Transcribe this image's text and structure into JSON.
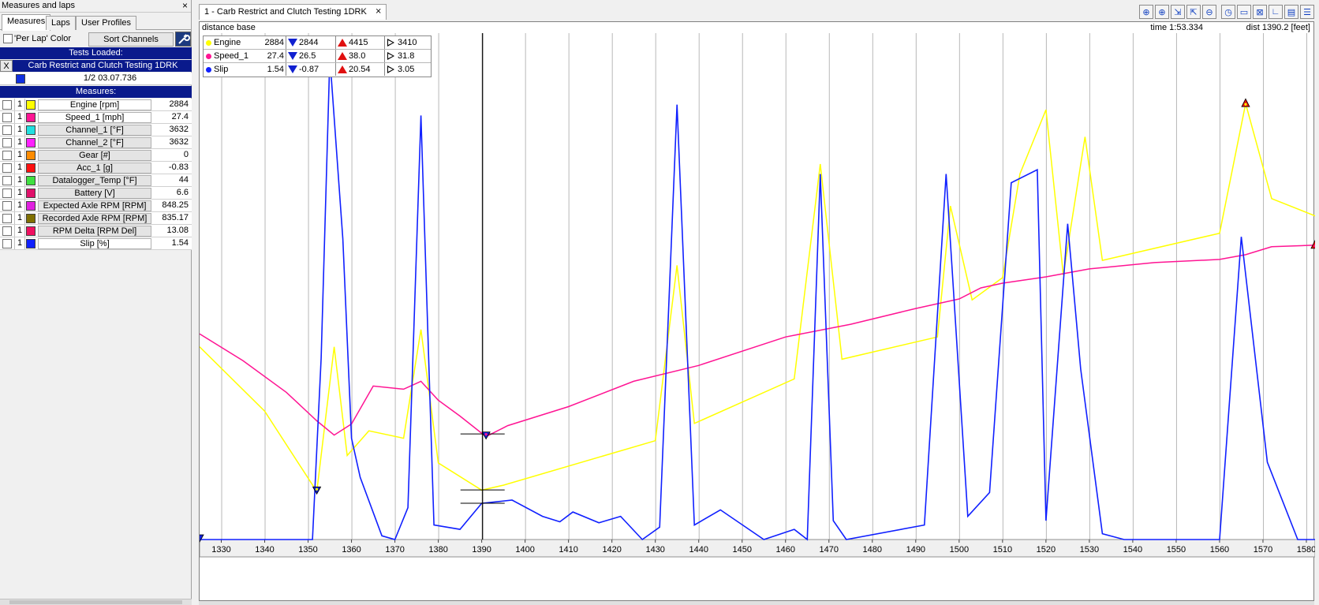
{
  "left_panel": {
    "title": "Measures and laps",
    "close": "×",
    "tabs": [
      "Measures",
      "Laps",
      "User Profiles"
    ],
    "per_lap_color": "'Per Lap' Color",
    "sort_channels": "Sort Channels",
    "tests_loaded": "Tests Loaded:",
    "test_close": "X",
    "test_name": "Carb Restrict and Clutch Testing 1DRK",
    "lap": "1/2 03.07.736",
    "measures_header": "Measures:",
    "measures": [
      {
        "num": "1",
        "color": "#ffff00",
        "label": "Engine     [rpm]",
        "value": "2884"
      },
      {
        "num": "1",
        "color": "#ff1493",
        "label": "Speed_1     [mph]",
        "value": "27.4"
      },
      {
        "num": "1",
        "color": "#20e0e0",
        "label": "Channel_1     [°F]",
        "value": "3632"
      },
      {
        "num": "1",
        "color": "#ff20ff",
        "label": "Channel_2     [°F]",
        "value": "3632"
      },
      {
        "num": "1",
        "color": "#ff8c00",
        "label": "Gear     [#]",
        "value": "0"
      },
      {
        "num": "1",
        "color": "#ff1010",
        "label": "Acc_1     [g]",
        "value": "-0.83"
      },
      {
        "num": "1",
        "color": "#40e040",
        "label": "Datalogger_Temp     [°F]",
        "value": "44"
      },
      {
        "num": "1",
        "color": "#e0106a",
        "label": "Battery     [V]",
        "value": "6.6"
      },
      {
        "num": "1",
        "color": "#e020e0",
        "label": "Expected Axle RPM     [RPM]",
        "value": "848.25"
      },
      {
        "num": "1",
        "color": "#807000",
        "label": "Recorded Axle RPM     [RPM]",
        "value": "835.17"
      },
      {
        "num": "1",
        "color": "#f01060",
        "label": "RPM Delta     [RPM Del]",
        "value": "13.08"
      },
      {
        "num": "1",
        "color": "#1020ff",
        "label": "Slip     [%]",
        "value": "1.54"
      }
    ]
  },
  "document": {
    "tab_title": "1 - Carb Restrict and Clutch Testing 1DRK",
    "tab_close": "⨯",
    "base": "distance base",
    "time": "time 1:53.334",
    "dist": "dist 1390.2 [feet]"
  },
  "toolbar": {
    "icons": [
      "zoom-2d-icon",
      "zoom-icon",
      "cursor-icon",
      "cursor-select-icon",
      "zoom-out-icon",
      "clock-icon",
      "image-icon",
      "no-image-icon",
      "layout-single-icon",
      "layout-split-icon",
      "layout-list-icon"
    ],
    "glyphs": [
      "⊕",
      "⊕",
      "⇲",
      "⇱",
      "⊖",
      "◷",
      "▭",
      "⊠",
      "∟",
      "▤",
      "☰"
    ]
  },
  "legend": [
    {
      "name": "Engine",
      "color": "#ffff00",
      "value": "2884",
      "min": "2844",
      "max": "4415",
      "avg": "3410"
    },
    {
      "name": "Speed_1",
      "color": "#ff1493",
      "value": "27.4",
      "min": "26.5",
      "max": "38.0",
      "avg": "31.8"
    },
    {
      "name": "Slip",
      "color": "#1020ff",
      "value": "1.54",
      "min": "-0.87",
      "max": "20.54",
      "avg": "3.05"
    }
  ],
  "chart_data": {
    "type": "line",
    "x_ticks": [
      1330,
      1340,
      1350,
      1360,
      1370,
      1380,
      1390,
      1400,
      1410,
      1420,
      1430,
      1440,
      1450,
      1460,
      1470,
      1480,
      1490,
      1500,
      1510,
      1520,
      1530,
      1540,
      1550,
      1560,
      1570,
      1580
    ],
    "xlim": [
      1325,
      1582
    ],
    "cursor_x": 1390.2,
    "grid": "vertical",
    "series": [
      {
        "name": "Engine",
        "color": "#ffff00",
        "ylim": [
          2650,
          4700
        ],
        "x": [
          1325,
          1340,
          1352,
          1356,
          1359,
          1364,
          1372,
          1376,
          1380,
          1390,
          1395,
          1430,
          1435,
          1439,
          1462,
          1468,
          1473,
          1495,
          1498,
          1503,
          1510,
          1514,
          1520,
          1524,
          1529,
          1533,
          1560,
          1566,
          1572,
          1582
        ],
        "y": [
          3430,
          3170,
          2844,
          3430,
          2990,
          3090,
          3060,
          3500,
          2960,
          2850,
          2870,
          3050,
          3760,
          3120,
          3300,
          4170,
          3380,
          3470,
          4000,
          3620,
          3710,
          4130,
          4390,
          3720,
          4280,
          3780,
          3890,
          4415,
          4030,
          3960
        ]
      },
      {
        "name": "Speed_1",
        "color": "#ff1493",
        "ylim": [
          20,
          52
        ],
        "x": [
          1325,
          1335,
          1345,
          1352,
          1356,
          1360,
          1365,
          1372,
          1376,
          1380,
          1385,
          1391,
          1396,
          1410,
          1425,
          1440,
          1460,
          1475,
          1490,
          1500,
          1505,
          1510,
          1520,
          1530,
          1545,
          1560,
          1566,
          1572,
          1582
        ],
        "y": [
          33.0,
          31.3,
          29.3,
          27.5,
          26.6,
          27.3,
          29.7,
          29.5,
          30.0,
          28.8,
          27.8,
          26.5,
          27.2,
          28.4,
          30.0,
          31.0,
          32.8,
          33.6,
          34.6,
          35.2,
          35.9,
          36.2,
          36.6,
          37.1,
          37.5,
          37.7,
          38.0,
          38.5,
          38.6
        ]
      },
      {
        "name": "Slip",
        "color": "#1020ff",
        "ylim": [
          -0.87,
          22.5
        ],
        "x": [
          1325,
          1351,
          1353,
          1355,
          1358,
          1360,
          1362,
          1367,
          1370,
          1373,
          1376,
          1379,
          1385,
          1390,
          1397,
          1404,
          1408,
          1411,
          1417,
          1422,
          1427,
          1431,
          1435,
          1439,
          1445,
          1455,
          1462,
          1465,
          1468,
          1471,
          1474,
          1492,
          1497,
          1502,
          1507,
          1512,
          1518,
          1520,
          1525,
          1528,
          1533,
          1538,
          1560,
          1565,
          1571,
          1578,
          1582
        ],
        "y": [
          -0.87,
          -0.87,
          7.5,
          21.4,
          13.0,
          3.8,
          2.0,
          -0.7,
          -0.87,
          0.6,
          18.7,
          -0.2,
          -0.4,
          0.8,
          0.95,
          0.2,
          -0.05,
          0.4,
          -0.1,
          0.2,
          -0.87,
          -0.3,
          19.2,
          -0.2,
          0.5,
          -0.87,
          -0.4,
          -0.87,
          16.0,
          0.0,
          -0.87,
          -0.2,
          16.0,
          0.2,
          1.3,
          15.6,
          16.2,
          0.0,
          13.7,
          7.0,
          -0.6,
          -0.87,
          -0.87,
          13.1,
          2.7,
          -0.87,
          -0.87
        ]
      }
    ]
  }
}
